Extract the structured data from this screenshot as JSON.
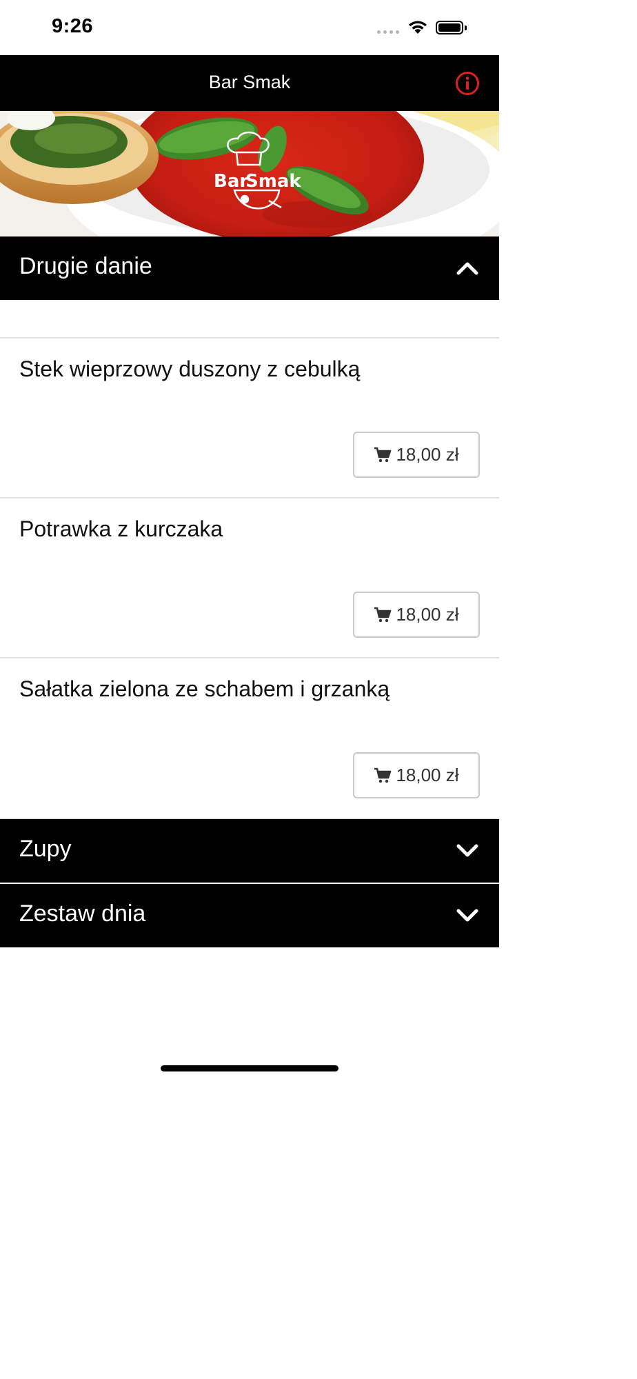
{
  "status": {
    "time": "9:26"
  },
  "nav": {
    "title": "Bar Smak"
  },
  "hero": {
    "logo_text_left": "Bar",
    "logo_text_right": "Smak"
  },
  "categories": [
    {
      "title": "Drugie danie",
      "expanded": true
    },
    {
      "title": "Zupy",
      "expanded": false
    },
    {
      "title": "Zestaw dnia",
      "expanded": false
    }
  ],
  "items": [
    {
      "name": "Stek wieprzowy duszony z cebulką",
      "price": "18,00 zł"
    },
    {
      "name": "Potrawka z kurczaka",
      "price": "18,00 zł"
    },
    {
      "name": "Sałatka zielona ze schabem i grzanką",
      "price": "18,00 zł"
    }
  ],
  "colors": {
    "nav_bg": "#000000",
    "accent": "#e02020",
    "border": "#c9c9c9"
  }
}
